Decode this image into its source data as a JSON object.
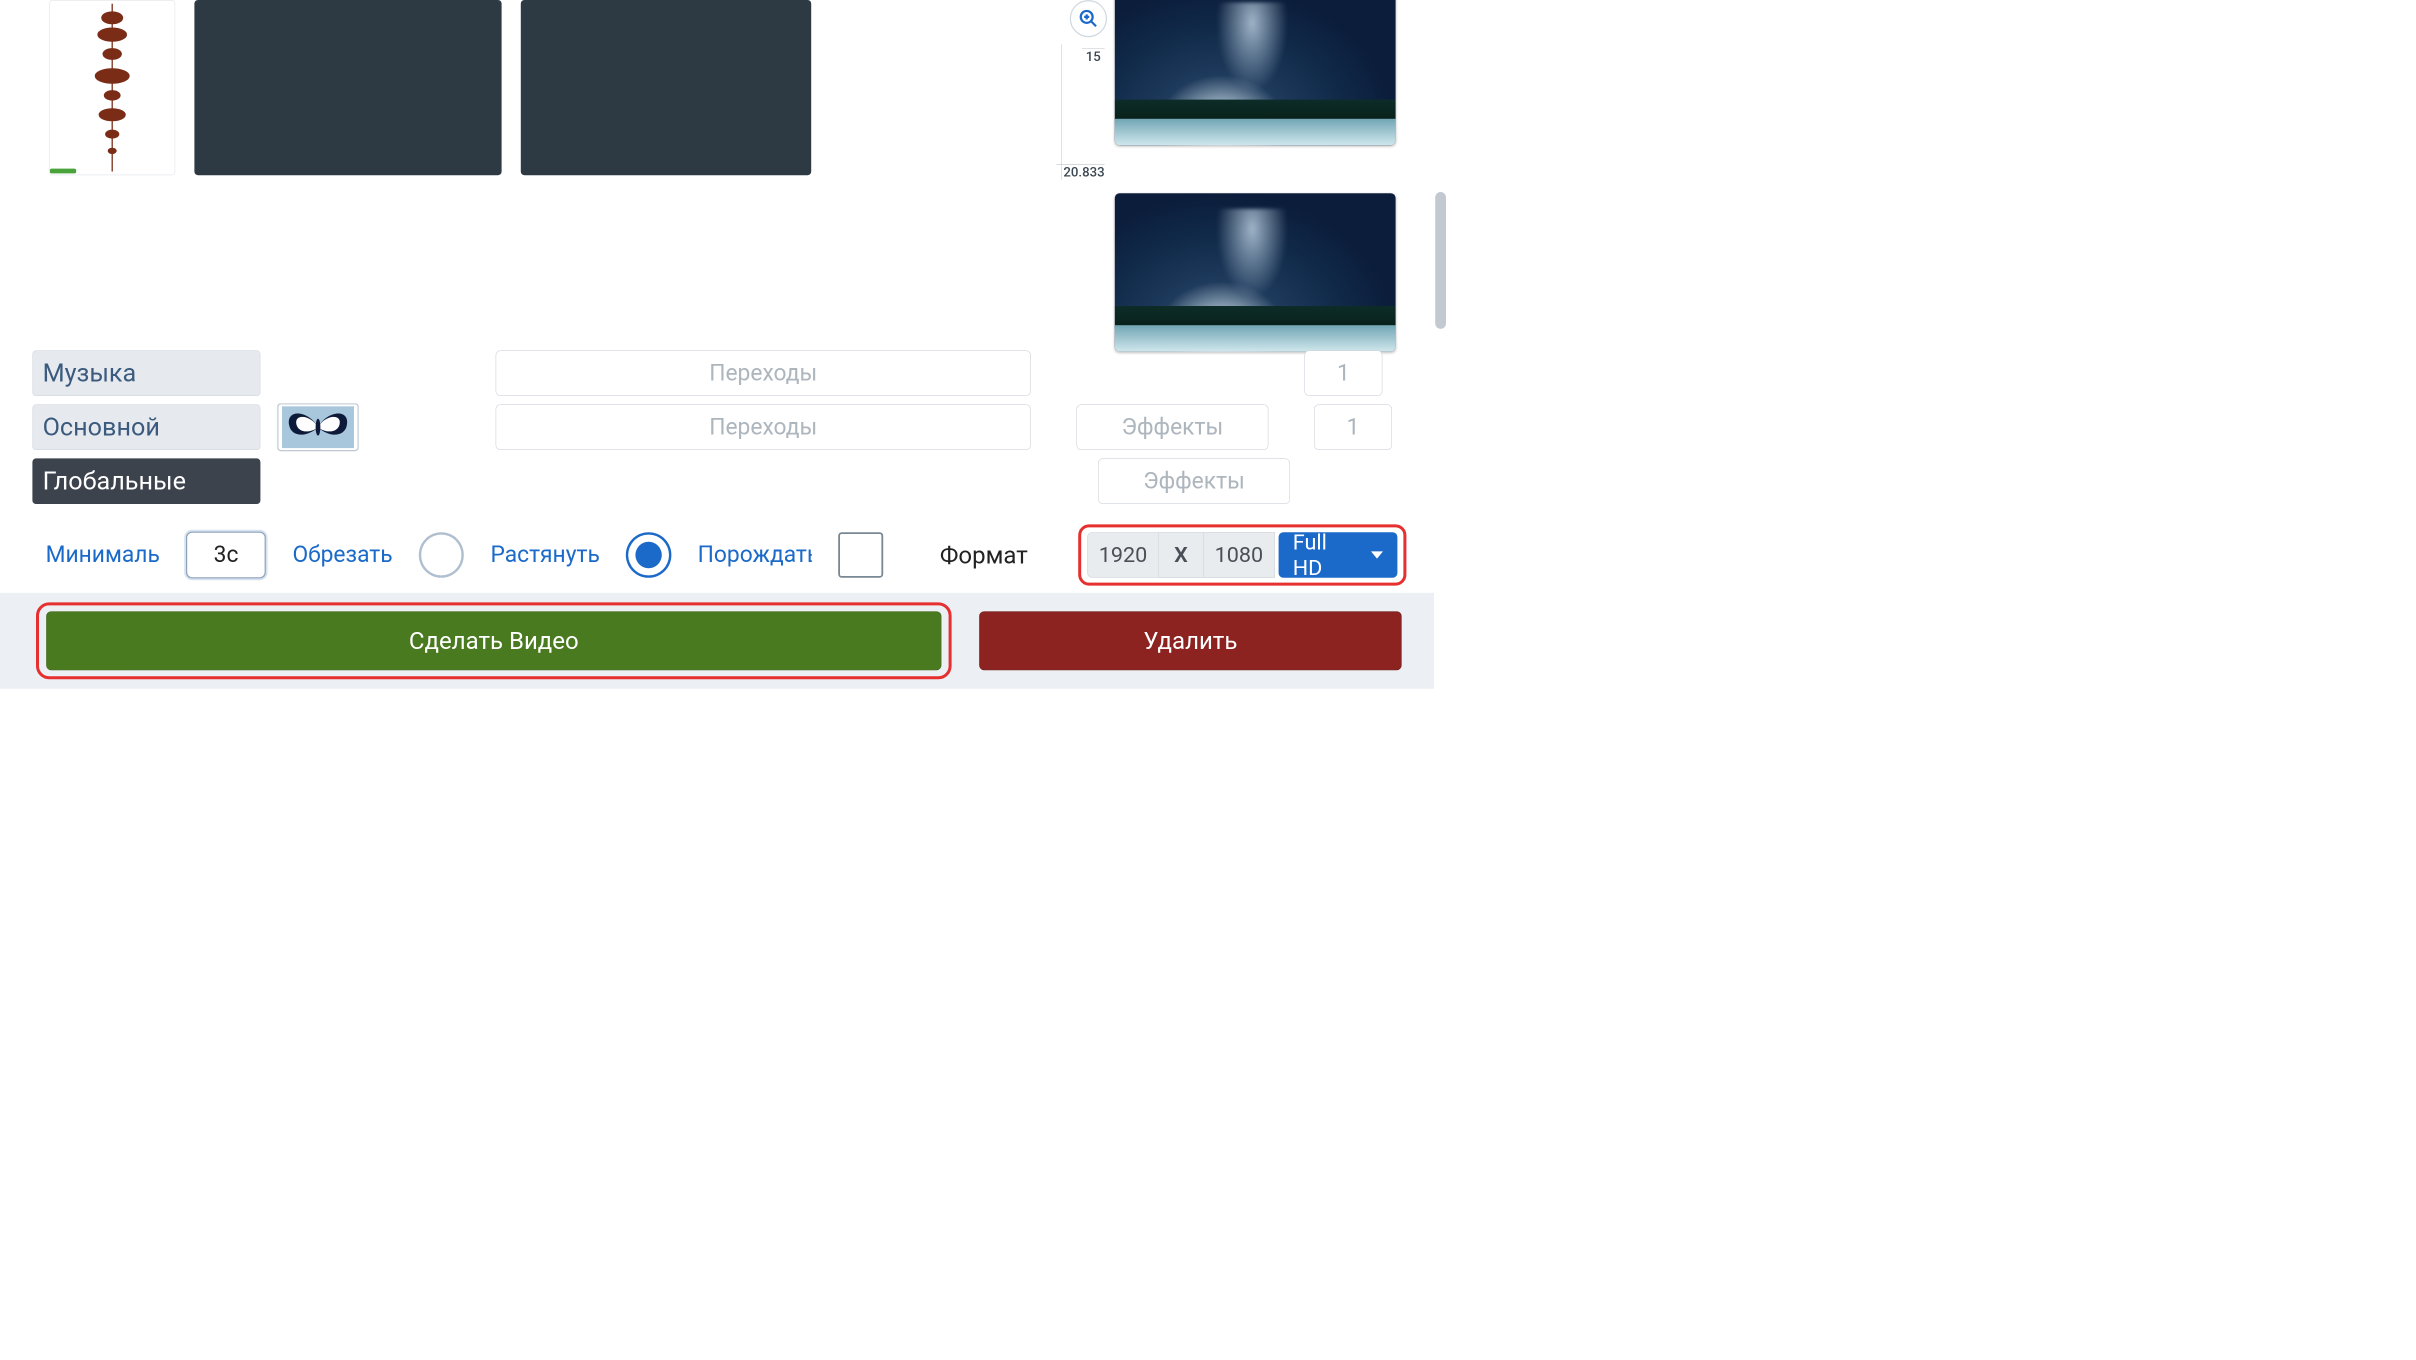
{
  "ruler": {
    "tick15": "15",
    "tick20": "20.833"
  },
  "tabs": {
    "music": "Музыка",
    "main": "Основной",
    "global": "Глобальные"
  },
  "buttons": {
    "transitions": "Переходы",
    "effects": "Эффекты",
    "count1": "1",
    "count2": "1"
  },
  "options": {
    "minimal_label": "Минимальн",
    "minimal_value": "3с",
    "crop_label": "Обрезать",
    "stretch_label": "Растянуть",
    "spawn_label": "Порождать",
    "format_label": "Формат",
    "width": "1920",
    "x": "X",
    "height": "1080",
    "preset": "Full HD"
  },
  "actions": {
    "make_video": "Сделать Видео",
    "delete": "Удалить"
  }
}
